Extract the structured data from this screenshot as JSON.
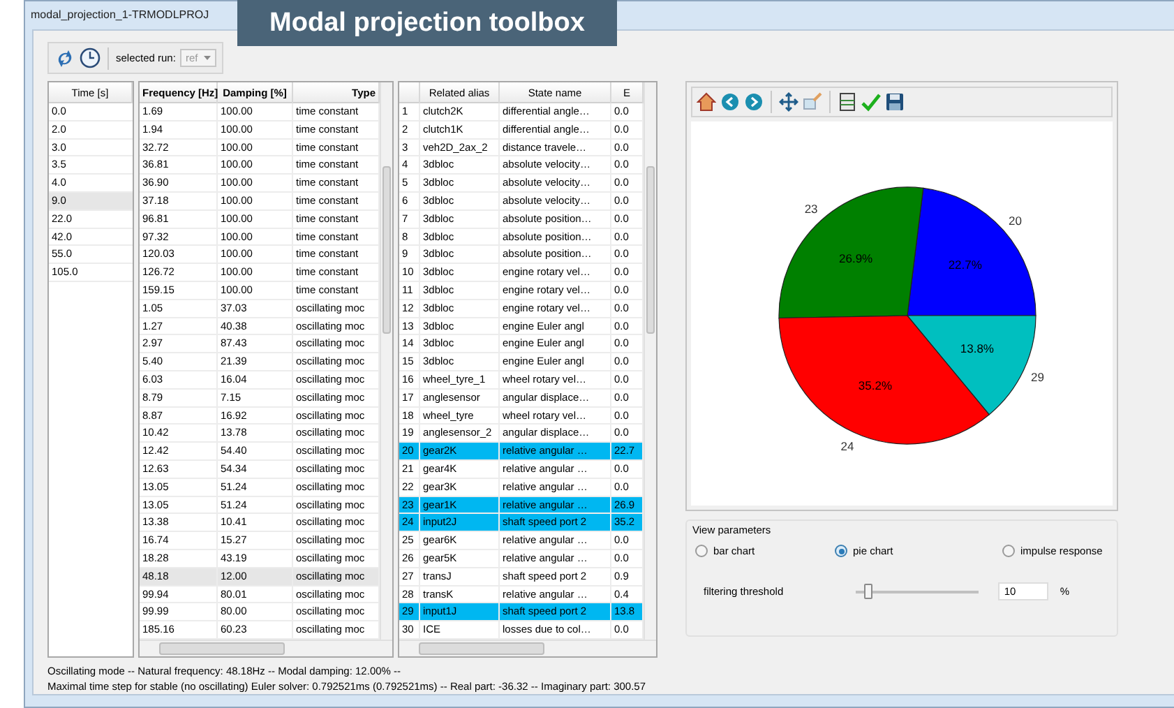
{
  "window": {
    "title": "modal_projection_1-TRMODLPROJ"
  },
  "banner": {
    "text": "Modal projection toolbox"
  },
  "toolbar": {
    "run_label": "selected run:",
    "run_value": "ref",
    "run_disabled": true
  },
  "time_table": {
    "columns": [
      "Time [s]"
    ],
    "rows": [
      {
        "value": "0.0",
        "selected": false
      },
      {
        "value": "2.0",
        "selected": false
      },
      {
        "value": "3.0",
        "selected": false
      },
      {
        "value": "3.5",
        "selected": false
      },
      {
        "value": "4.0",
        "selected": false
      },
      {
        "value": "9.0",
        "selected": true
      },
      {
        "value": "22.0",
        "selected": false
      },
      {
        "value": "42.0",
        "selected": false
      },
      {
        "value": "55.0",
        "selected": false
      },
      {
        "value": "105.0",
        "selected": false
      }
    ]
  },
  "modes_table": {
    "columns": [
      "Frequency [Hz]",
      "Damping [%]",
      "Type"
    ],
    "rows": [
      {
        "frequency": "1.69",
        "damping": "100.00",
        "type": "time constant",
        "selected": false
      },
      {
        "frequency": "1.94",
        "damping": "100.00",
        "type": "time constant",
        "selected": false
      },
      {
        "frequency": "32.72",
        "damping": "100.00",
        "type": "time constant",
        "selected": false
      },
      {
        "frequency": "36.81",
        "damping": "100.00",
        "type": "time constant",
        "selected": false
      },
      {
        "frequency": "36.90",
        "damping": "100.00",
        "type": "time constant",
        "selected": false
      },
      {
        "frequency": "37.18",
        "damping": "100.00",
        "type": "time constant",
        "selected": false
      },
      {
        "frequency": "96.81",
        "damping": "100.00",
        "type": "time constant",
        "selected": false
      },
      {
        "frequency": "97.32",
        "damping": "100.00",
        "type": "time constant",
        "selected": false
      },
      {
        "frequency": "120.03",
        "damping": "100.00",
        "type": "time constant",
        "selected": false
      },
      {
        "frequency": "126.72",
        "damping": "100.00",
        "type": "time constant",
        "selected": false
      },
      {
        "frequency": "159.15",
        "damping": "100.00",
        "type": "time constant",
        "selected": false
      },
      {
        "frequency": "1.05",
        "damping": "37.03",
        "type": "oscillating moc",
        "selected": false
      },
      {
        "frequency": "1.27",
        "damping": "40.38",
        "type": "oscillating moc",
        "selected": false
      },
      {
        "frequency": "2.97",
        "damping": "87.43",
        "type": "oscillating moc",
        "selected": false
      },
      {
        "frequency": "5.40",
        "damping": "21.39",
        "type": "oscillating moc",
        "selected": false
      },
      {
        "frequency": "6.03",
        "damping": "16.04",
        "type": "oscillating moc",
        "selected": false
      },
      {
        "frequency": "8.79",
        "damping": "7.15",
        "type": "oscillating moc",
        "selected": false
      },
      {
        "frequency": "8.87",
        "damping": "16.92",
        "type": "oscillating moc",
        "selected": false
      },
      {
        "frequency": "10.42",
        "damping": "13.78",
        "type": "oscillating moc",
        "selected": false
      },
      {
        "frequency": "12.42",
        "damping": "54.40",
        "type": "oscillating moc",
        "selected": false
      },
      {
        "frequency": "12.63",
        "damping": "54.34",
        "type": "oscillating moc",
        "selected": false
      },
      {
        "frequency": "13.05",
        "damping": "51.24",
        "type": "oscillating moc",
        "selected": false
      },
      {
        "frequency": "13.05",
        "damping": "51.24",
        "type": "oscillating moc",
        "selected": false
      },
      {
        "frequency": "13.38",
        "damping": "10.41",
        "type": "oscillating moc",
        "selected": false
      },
      {
        "frequency": "16.74",
        "damping": "15.27",
        "type": "oscillating moc",
        "selected": false
      },
      {
        "frequency": "18.28",
        "damping": "43.19",
        "type": "oscillating moc",
        "selected": false
      },
      {
        "frequency": "48.18",
        "damping": "12.00",
        "type": "oscillating moc",
        "selected": true
      },
      {
        "frequency": "99.94",
        "damping": "80.01",
        "type": "oscillating moc",
        "selected": false
      },
      {
        "frequency": "99.99",
        "damping": "80.00",
        "type": "oscillating moc",
        "selected": false
      },
      {
        "frequency": "185.16",
        "damping": "60.23",
        "type": "oscillating moc",
        "selected": false
      }
    ]
  },
  "states_table": {
    "columns": [
      "Related alias",
      "State name",
      "E"
    ],
    "rows": [
      {
        "index": "1",
        "alias": "clutch2K",
        "state": "differential angle…",
        "e": "0.0",
        "selected": false
      },
      {
        "index": "2",
        "alias": "clutch1K",
        "state": "differential angle…",
        "e": "0.0",
        "selected": false
      },
      {
        "index": "3",
        "alias": "veh2D_2ax_2",
        "state": "distance travele…",
        "e": "0.0",
        "selected": false
      },
      {
        "index": "4",
        "alias": "3dbloc",
        "state": "absolute velocity…",
        "e": "0.0",
        "selected": false
      },
      {
        "index": "5",
        "alias": "3dbloc",
        "state": "absolute velocity…",
        "e": "0.0",
        "selected": false
      },
      {
        "index": "6",
        "alias": "3dbloc",
        "state": "absolute velocity…",
        "e": "0.0",
        "selected": false
      },
      {
        "index": "7",
        "alias": "3dbloc",
        "state": "absolute position…",
        "e": "0.0",
        "selected": false
      },
      {
        "index": "8",
        "alias": "3dbloc",
        "state": "absolute position…",
        "e": "0.0",
        "selected": false
      },
      {
        "index": "9",
        "alias": "3dbloc",
        "state": "absolute position…",
        "e": "0.0",
        "selected": false
      },
      {
        "index": "10",
        "alias": "3dbloc",
        "state": "engine rotary vel…",
        "e": "0.0",
        "selected": false
      },
      {
        "index": "11",
        "alias": "3dbloc",
        "state": "engine rotary vel…",
        "e": "0.0",
        "selected": false
      },
      {
        "index": "12",
        "alias": "3dbloc",
        "state": "engine rotary vel…",
        "e": "0.0",
        "selected": false
      },
      {
        "index": "13",
        "alias": "3dbloc",
        "state": "engine Euler angl",
        "e": "0.0",
        "selected": false
      },
      {
        "index": "14",
        "alias": "3dbloc",
        "state": "engine Euler angl",
        "e": "0.0",
        "selected": false
      },
      {
        "index": "15",
        "alias": "3dbloc",
        "state": "engine Euler angl",
        "e": "0.0",
        "selected": false
      },
      {
        "index": "16",
        "alias": "wheel_tyre_1",
        "state": "wheel rotary vel…",
        "e": "0.0",
        "selected": false
      },
      {
        "index": "17",
        "alias": "anglesensor",
        "state": "angular displace…",
        "e": "0.0",
        "selected": false
      },
      {
        "index": "18",
        "alias": "wheel_tyre",
        "state": "wheel rotary vel…",
        "e": "0.0",
        "selected": false
      },
      {
        "index": "19",
        "alias": "anglesensor_2",
        "state": "angular displace…",
        "e": "0.0",
        "selected": false
      },
      {
        "index": "20",
        "alias": "gear2K",
        "state": "relative angular …",
        "e": "22.7",
        "selected": true
      },
      {
        "index": "21",
        "alias": "gear4K",
        "state": "relative angular …",
        "e": "0.0",
        "selected": false
      },
      {
        "index": "22",
        "alias": "gear3K",
        "state": "relative angular …",
        "e": "0.0",
        "selected": false
      },
      {
        "index": "23",
        "alias": "gear1K",
        "state": "relative angular …",
        "e": "26.9",
        "selected": true
      },
      {
        "index": "24",
        "alias": "input2J",
        "state": "shaft speed port 2",
        "e": "35.2",
        "selected": true
      },
      {
        "index": "25",
        "alias": "gear6K",
        "state": "relative angular …",
        "e": "0.0",
        "selected": false
      },
      {
        "index": "26",
        "alias": "gear5K",
        "state": "relative angular …",
        "e": "0.0",
        "selected": false
      },
      {
        "index": "27",
        "alias": "transJ",
        "state": "shaft speed port 2",
        "e": "0.9",
        "selected": false
      },
      {
        "index": "28",
        "alias": "transK",
        "state": "relative angular …",
        "e": "0.4",
        "selected": false
      },
      {
        "index": "29",
        "alias": "input1J",
        "state": "shaft speed port 2",
        "e": "13.8",
        "selected": true
      },
      {
        "index": "30",
        "alias": "ICE",
        "state": "losses due to col…",
        "e": "0.0",
        "selected": false
      }
    ]
  },
  "plot": {
    "chart_data": {
      "type": "pie",
      "categories": [
        "20",
        "23",
        "24",
        "29"
      ],
      "values": [
        22.7,
        26.9,
        35.2,
        13.8
      ],
      "colors": [
        "#0000ff",
        "#008000",
        "#ff0000",
        "#00bfbf"
      ],
      "value_labels": [
        "22.7%",
        "26.9%",
        "35.2%",
        "13.8%"
      ]
    }
  },
  "view_parameters": {
    "title": "View parameters",
    "options": [
      {
        "label": "bar chart",
        "selected": false
      },
      {
        "label": "pie chart",
        "selected": true
      },
      {
        "label": "impulse response",
        "selected": false
      }
    ],
    "threshold": {
      "label": "filtering threshold",
      "level": 0.1,
      "value": "10",
      "unit": "%"
    }
  },
  "status": [
    "Oscillating mode -- Natural frequency: 48.18Hz -- Modal damping: 12.00% --",
    "Maximal time step for stable (no oscillating) Euler solver: 0.792521ms (0.792521ms) -- Real part: -36.32 -- Imaginary part: 300.57"
  ]
}
